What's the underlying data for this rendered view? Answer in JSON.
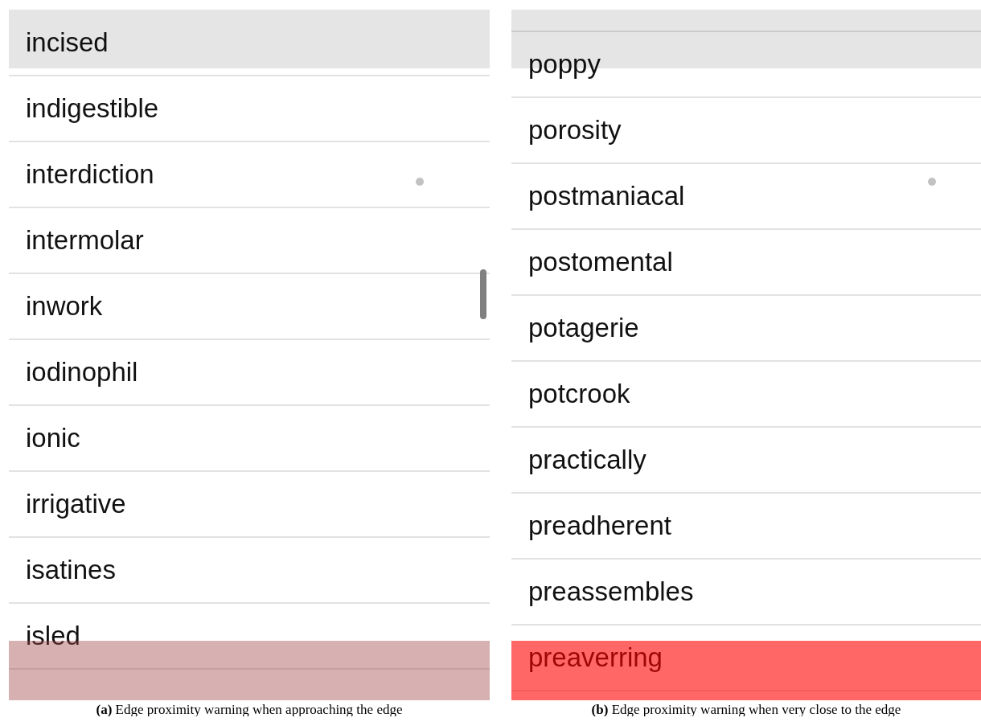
{
  "panels": [
    {
      "rows": [
        {
          "text": "incised"
        },
        {
          "text": "indigestible"
        },
        {
          "text": "interdiction"
        },
        {
          "text": "intermolar"
        },
        {
          "text": "inwork"
        },
        {
          "text": "iodinophil"
        },
        {
          "text": "ionic"
        },
        {
          "text": "irrigative"
        },
        {
          "text": "isatines"
        },
        {
          "text": "isled"
        }
      ],
      "top_warning": true,
      "bottom_warning": {
        "kind": "mild"
      },
      "scrollbar": true,
      "caption": "**(a)** Edge proximity warning when approaching the edge"
    },
    {
      "rows": [
        {
          "text": "poppy"
        },
        {
          "text": "porosity"
        },
        {
          "text": "postmaniacal"
        },
        {
          "text": "postomental"
        },
        {
          "text": "potagerie"
        },
        {
          "text": "potcrook"
        },
        {
          "text": "practically"
        },
        {
          "text": "preadherent"
        },
        {
          "text": "preassembles"
        },
        {
          "text": "preaverring"
        }
      ],
      "top_warning": true,
      "bottom_warning": {
        "kind": "strong"
      },
      "scrollbar": false,
      "caption": "**(b)** Edge proximity warning when very close to the edge"
    }
  ]
}
